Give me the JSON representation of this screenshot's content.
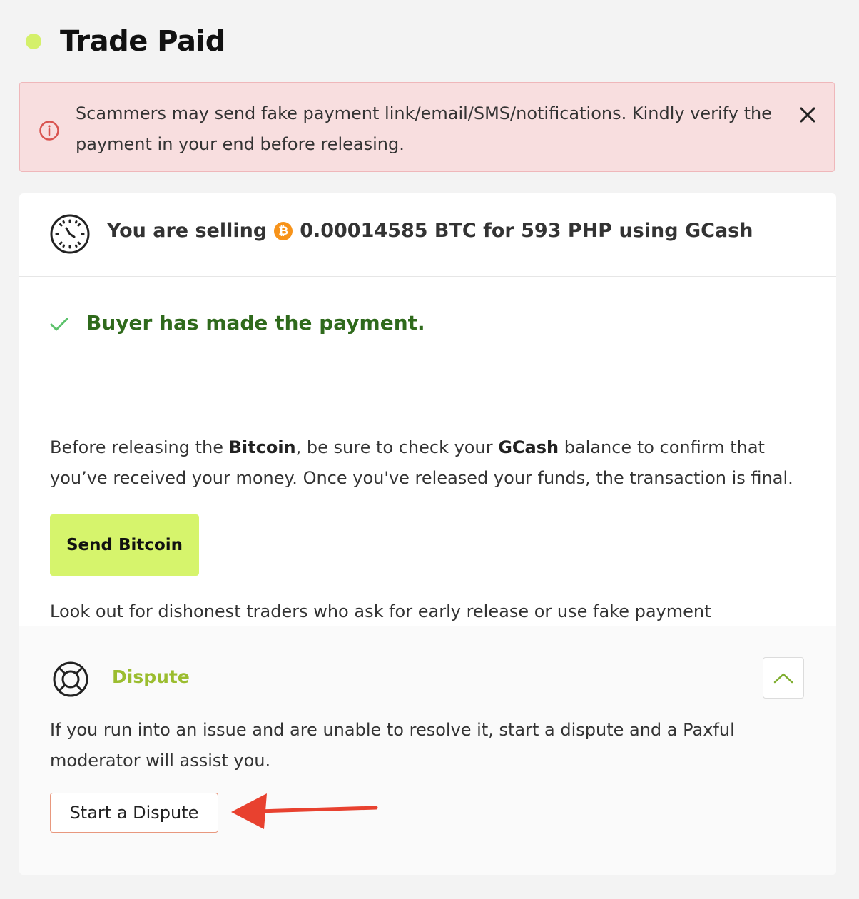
{
  "header": {
    "title": "Trade Paid",
    "status_color": "#d4f06a"
  },
  "alert": {
    "text": "Scammers may send fake payment link/email/SMS/notifications. Kindly verify the payment in your end before releasing.",
    "icon": "info-circle-icon",
    "close_icon": "close-icon"
  },
  "trade": {
    "prefix": "You are selling",
    "crypto_icon": "bitcoin-icon",
    "crypto_symbol": "₿",
    "details": "0.00014585 BTC for 593 PHP using GCash"
  },
  "payment": {
    "title": "Buyer has made the payment.",
    "instruction_1": "Before releasing the ",
    "instruction_bold_1": "Bitcoin",
    "instruction_2": ", be sure to check your ",
    "instruction_bold_2": "GCash",
    "instruction_3": " balance to confirm that you’ve received your money. Once you've released your funds, the transaction is final.",
    "send_button": "Send Bitcoin",
    "warning": "Look out for dishonest traders who ask for early release or use fake payment screenshots. Make sure you’ve received your money before releasing the crypto."
  },
  "dispute": {
    "title": "Dispute",
    "description": "If you run into an issue and are unable to resolve it, start a dispute and a Paxful moderator will assist you.",
    "button": "Start a Dispute"
  },
  "colors": {
    "accent": "#d6f46c",
    "success_text": "#2f6a1c",
    "dispute_green": "#9bbd2f",
    "alert_bg": "#f8dedf",
    "annotation_arrow": "#e8412f"
  }
}
